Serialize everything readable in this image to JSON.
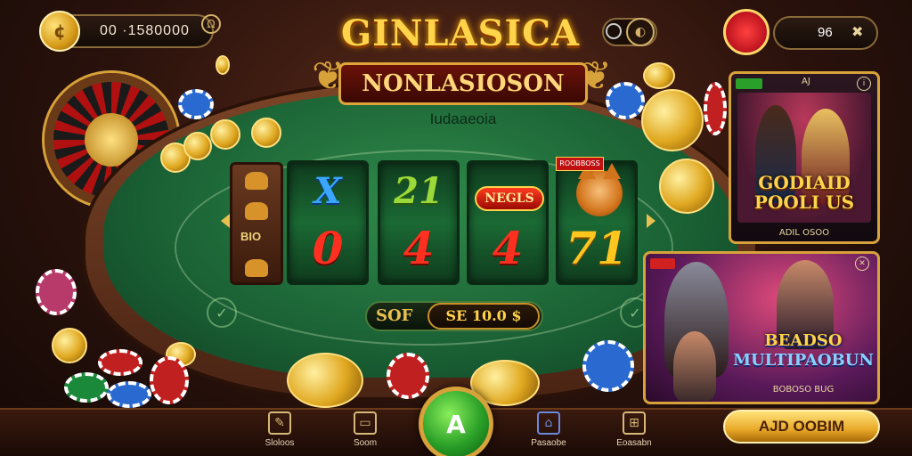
{
  "top_bar": {
    "balance": "00 ·1580000",
    "info_label": "",
    "badge_value": "96",
    "badge_close": "✖"
  },
  "title": {
    "main": "GINLASICA",
    "sub": "NONLASIOSON",
    "table_subtitle": "Iudaaeoia"
  },
  "reels": {
    "left_text": "BIO",
    "col1_top": "X",
    "col1_bottom": "0",
    "col2_top": "21",
    "col2_bottom": "4",
    "col3_top": "NEGLS",
    "col3_bottom": "4",
    "col4_tag": "ROOBBOSS",
    "col4_bottom": "71"
  },
  "bet": {
    "label": "SOF",
    "value": "SE 10.0 $"
  },
  "promo_card_1": {
    "top_label": "AJ",
    "title_line1": "GODIAID",
    "title_line2": "POOLI US",
    "footer": "ADIL OSOO"
  },
  "promo_card_2": {
    "title_line1": "BEADSO",
    "title_line2": "MULTIPAOBUN",
    "footer": "BOBOSO BUG"
  },
  "bottom_nav": {
    "items": [
      {
        "label": "Sloloos",
        "icon": "pencil-icon"
      },
      {
        "label": "Soom",
        "icon": "monitor-icon"
      },
      {
        "label": "Pasaobe",
        "icon": "bag-icon"
      },
      {
        "label": "Eoasabn",
        "icon": "gift-icon"
      }
    ],
    "play_label": "A",
    "cta_label": "AJD OOBIM"
  },
  "colors": {
    "felt": "#1a6034",
    "gold": "#ffd34a",
    "rim": "#7a4426",
    "play": "#2aa028"
  }
}
